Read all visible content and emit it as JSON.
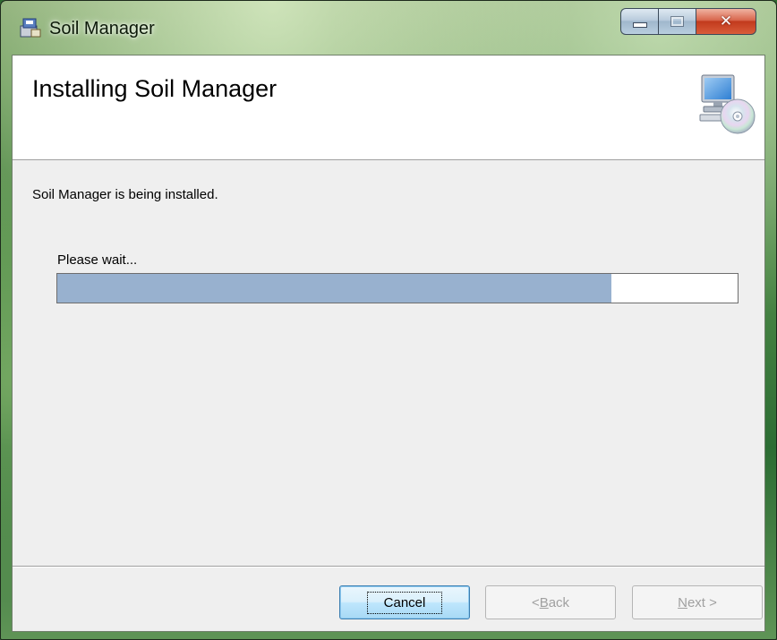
{
  "window": {
    "title": "Soil Manager",
    "app_icon": "installer-icon",
    "close_glyph": "✕"
  },
  "banner": {
    "title": "Installing Soil Manager",
    "icon": "computer-cd-icon"
  },
  "body": {
    "status_text": "Soil Manager is being installed.",
    "wait_text": "Please wait..."
  },
  "progress": {
    "fraction": 0.815,
    "fill_color": "#98b1cf"
  },
  "buttons": {
    "cancel": "Cancel",
    "back_prefix": "< ",
    "back_accel": "B",
    "back_rest": "ack",
    "next_accel": "N",
    "next_rest": "ext >"
  }
}
